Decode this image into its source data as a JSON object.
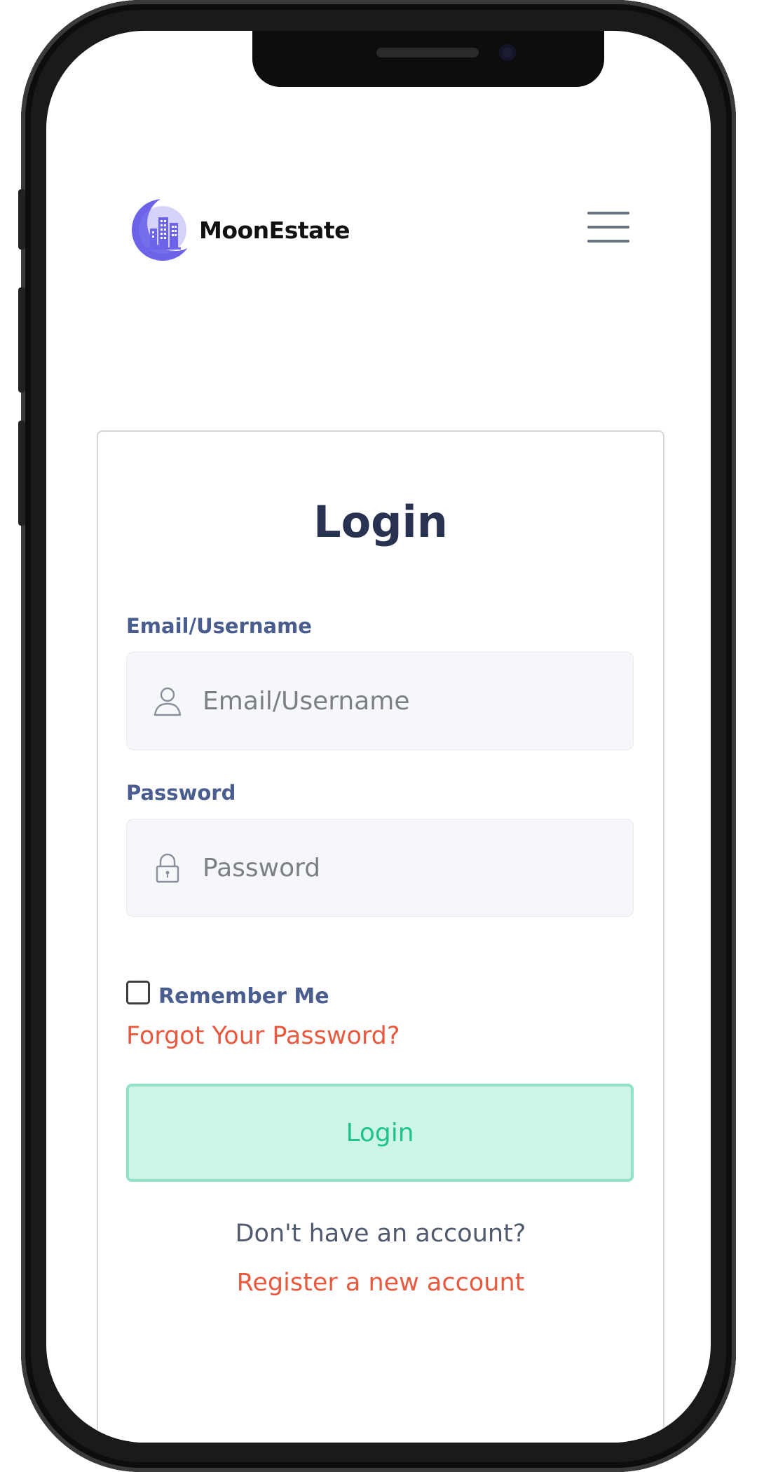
{
  "brand": {
    "name": "MoonEstate",
    "logo_icon": "moon-building-logo-icon",
    "logo_color": "#6c63e8"
  },
  "header": {
    "menu_icon": "hamburger-menu-icon"
  },
  "login_form": {
    "title": "Login",
    "email_label": "Email/Username",
    "email_placeholder": "Email/Username",
    "email_value": "",
    "password_label": "Password",
    "password_placeholder": "Password",
    "password_value": "",
    "remember_label": "Remember Me",
    "remember_checked": false,
    "forgot_link": "Forgot Your Password?",
    "submit_label": "Login",
    "no_account_text": "Don't have an account?",
    "register_link": "Register a new account"
  },
  "colors": {
    "title": "#283352",
    "label": "#4a5d8f",
    "link": "#e8593f",
    "button_bg": "#ccf4e7",
    "button_border": "#8fe2c6",
    "button_text": "#21c28b",
    "field_bg": "#f6f7fb"
  }
}
